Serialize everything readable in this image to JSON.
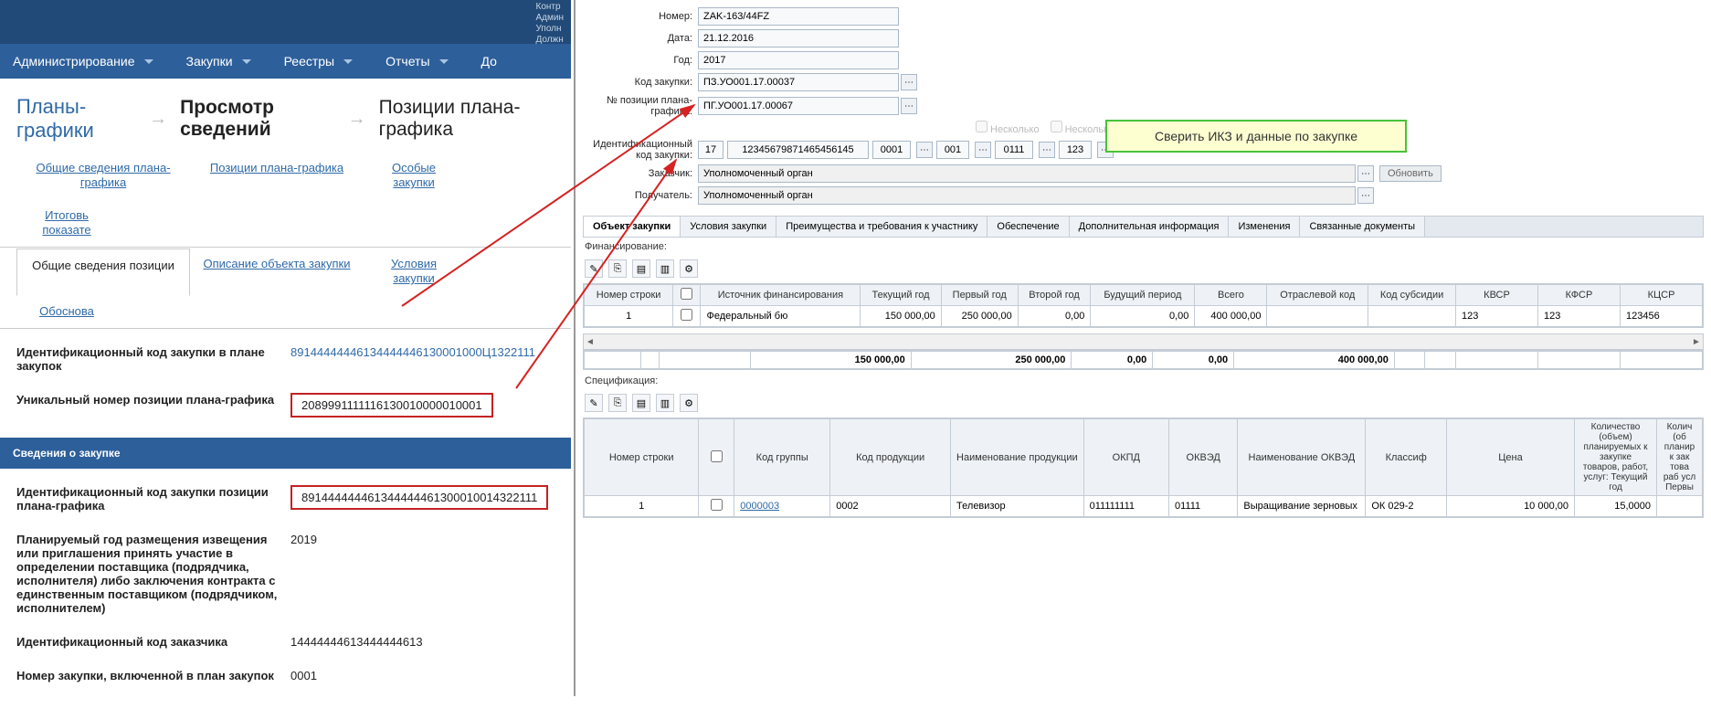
{
  "nav": {
    "admin": "Администрирование",
    "zakupki": "Закупки",
    "reestry": "Реестры",
    "otchety": "Отчеты",
    "do": "До"
  },
  "slinks": [
    "Контр",
    "Админ",
    "Уполн",
    "Должн"
  ],
  "breadcrumb": {
    "a": "Планы-графики",
    "b": "Просмотр сведений",
    "c": "Позиции плана-графика"
  },
  "ltabs": {
    "t1": "Общие сведения плана-графика",
    "t2": "Позиции плана-графика",
    "t3": "Особые закупки",
    "t4": "Итоговь показате",
    "t5": "Общие сведения позиции",
    "t6": "Описание объекта закупки",
    "t7": "Условия закупки",
    "t8": "Обоснова"
  },
  "fields": {
    "f1l": "Идентификационный код закупки в плане закупок",
    "f1v": "89144444446134444446130001000Ц1322111",
    "f2l": "Уникальный номер позиции плана-графика",
    "f2v": "2089991111116130010000010001",
    "sec": "Сведения о закупке",
    "f3l": "Идентификационный код закупки позиции плана-графика",
    "f3v": "891444444461344444461300010014322111",
    "f4l": "Планируемый год размещения извещения или приглашения принять участие в определении поставщика (подрядчика, исполнителя) либо заключения контракта с единственным поставщиком (подрядчиком, исполнителем)",
    "f4v": "2019",
    "f5l": "Идентификационный код заказчика",
    "f5v": "14444444613444444613",
    "f6l": "Номер закупки, включенной в план закупок",
    "f6v": "0001"
  },
  "rform": {
    "num_l": "Номер:",
    "num_v": "ZAK-163/44FZ",
    "date_l": "Дата:",
    "date_v": "21.12.2016",
    "year_l": "Год:",
    "year_v": "2017",
    "kod_l": "Код закупки:",
    "kod_v": "ПЗ.УО001.17.00037",
    "pos_l": "№ позиции плана-графика:",
    "pos_v": "ПГ.УО001.17.00067",
    "ikz_l": "Идентификационный код закупки:",
    "ikz": {
      "a": "17",
      "b": "12345679871465456145",
      "c": "0001",
      "d": "001",
      "e": "0111",
      "f": "123"
    },
    "zak_l": "Заказчик:",
    "zak_v": "Уполномоченный орган",
    "pol_l": "Получатель:",
    "pol_v": "Уполномоченный орган",
    "nes": "Несколько",
    "refresh": "Обновить"
  },
  "rtabs": {
    "t1": "Объект закупки",
    "t2": "Условия закупки",
    "t3": "Преимущества и требования к участнику",
    "t4": "Обеспечение",
    "t5": "Дополнительная информация",
    "t6": "Изменения",
    "t7": "Связанные документы"
  },
  "fin": {
    "hdr": "Финансирование:",
    "cols": {
      "c1": "Номер строки",
      "c2": "Источник финансирования",
      "c3": "Текущий год",
      "c4": "Первый год",
      "c5": "Второй год",
      "c6": "Будущий период",
      "c7": "Всего",
      "c8": "Отраслевой код",
      "c9": "Код субсидии",
      "c10": "КВСР",
      "c11": "КФСР",
      "c12": "КЦСР"
    },
    "row": {
      "n": "1",
      "src": "Федеральный бю",
      "cy": "150 000,00",
      "y1": "250 000,00",
      "y2": "0,00",
      "fp": "0,00",
      "tot": "400 000,00",
      "ok": "",
      "ks": "",
      "kvsr": "123",
      "kfsr": "123",
      "kcsr": "123456"
    },
    "totals": {
      "cy": "150 000,00",
      "y1": "250 000,00",
      "y2": "0,00",
      "fp": "0,00",
      "tot": "400 000,00"
    }
  },
  "spec": {
    "hdr": "Спецификация:",
    "cols": {
      "c1": "Номер строки",
      "c2": "Код группы",
      "c3": "Код продукции",
      "c4": "Наименование продукции",
      "c5": "ОКПД",
      "c6": "ОКВЭД",
      "c7": "Наименование ОКВЭД",
      "c8": "Классиф",
      "c9": "Цена",
      "c10": "Количество (объем) планируемых к закупке товаров, работ, услуг: Текущий год",
      "c11": "Колич (об планир к зак това раб усл Первы"
    },
    "row": {
      "n": "1",
      "kg": "0000003",
      "kp": "0002",
      "name": "Телевизор",
      "okpd": "011111111",
      "okved": "01111",
      "nokved": "Выращивание зерновых",
      "klass": "ОК 029-2",
      "price": "10 000,00",
      "qty": "15,0000"
    }
  },
  "callout": "Сверить ИКЗ и данные по закупке"
}
